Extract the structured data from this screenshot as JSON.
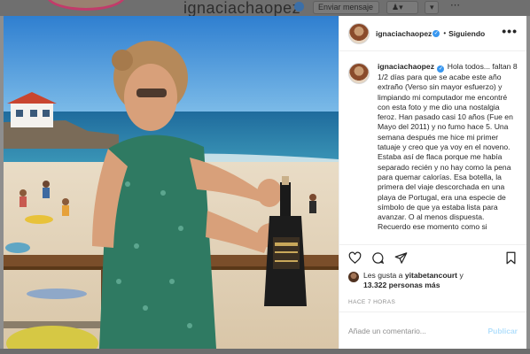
{
  "background_page": {
    "profile_username": "ignaciachaopez",
    "send_message_button": "Enviar mensaje"
  },
  "post": {
    "username": "ignaciachaopez",
    "follow_separator": "•",
    "follow_status": "Siguiendo",
    "more_label": "•••",
    "caption_username": "ignaciachaopez",
    "caption_text": "Hola todos... faltan 8 1/2 días para que se acabe este año extraño (Verso sin mayor esfuerzo) y limpiando mi computador me encontré con esta foto y me dio una nostalgia feroz. Han pasado casi 10 años (Fue en Mayo del 2011) y no fumo hace 5. Una semana después me hice mi primer tatuaje y creo que ya voy en el noveno. Estaba así de flaca porque me había separado recién y no hay como la pena para quemar calorías. Esa botella, la primera del viaje descorchada en una playa de Portugal, era una especie de símbolo de que ya estaba lista para avanzar. O al menos dispuesta. Recuerdo ese momento como si",
    "likes_prefix": "Les gusta a",
    "likes_user": "yitabetancourt",
    "likes_connector": "y",
    "likes_count": "13.322 personas más",
    "timestamp": "HACE 7 HORAS",
    "comment_placeholder": "Añade un comentario...",
    "post_button": "Publicar"
  },
  "colors": {
    "accent": "#3897f0",
    "post_disabled": "#b2dffc",
    "overlay": "#8e8e8e"
  },
  "icons": [
    "heart-icon",
    "comment-icon",
    "share-icon",
    "bookmark-icon",
    "more-options-icon",
    "verified-badge-icon"
  ]
}
